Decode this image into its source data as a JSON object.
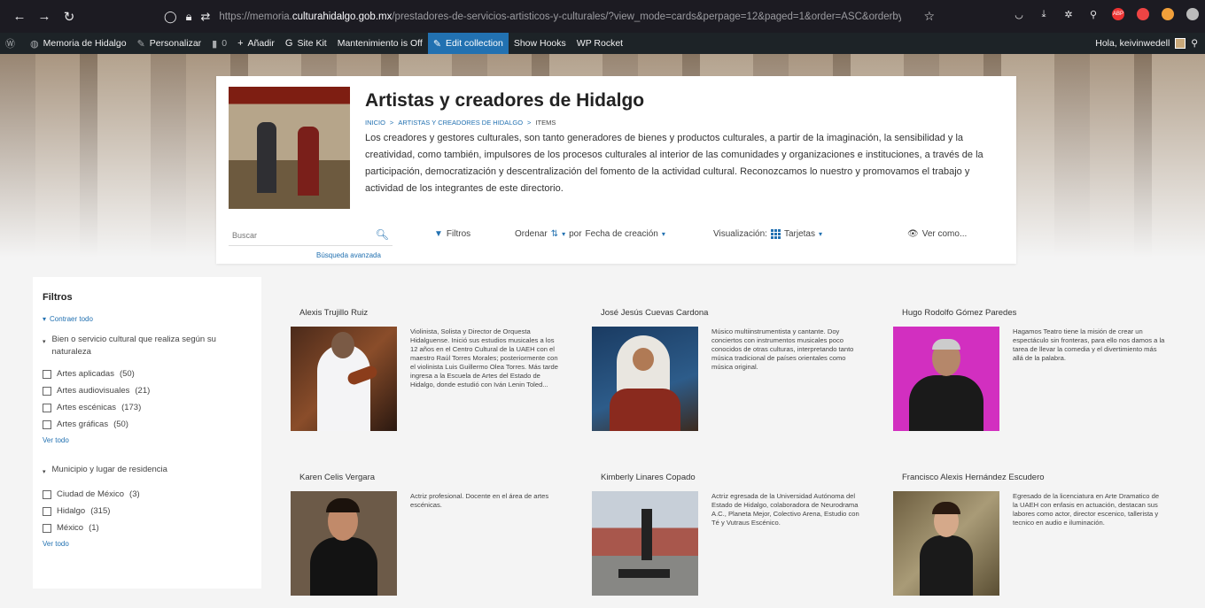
{
  "browser": {
    "url_prefix": "https://memoria.",
    "url_domain": "culturahidalgo.gob.mx",
    "url_path": "/prestadores-de-servicios-artisticos-y-culturales/?view_mode=cards&perpage=12&paged=1&order=ASC&orderby=date&fetch_only=thumbna"
  },
  "admin_bar": {
    "site_name": "Memoria de Hidalgo",
    "customize": "Personalizar",
    "comments_count": "0",
    "add_new": "Añadir",
    "site_kit": "Site Kit",
    "maintenance": "Mantenimiento is Off",
    "edit_collection": "Edit collection",
    "show_hooks": "Show Hooks",
    "wp_rocket": "WP Rocket",
    "greeting": "Hola, keivinwedell"
  },
  "header": {
    "title": "Artistas y creadores de Hidalgo",
    "breadcrumb": [
      "INICIO",
      "ARTISTAS Y CREADORES DE HIDALGO",
      "ITEMS"
    ],
    "breadcrumb_sep": ">",
    "description": "Los creadores y gestores culturales, son tanto generadores de bienes y productos culturales, a partir de la imaginación, la sensibilidad y la creatividad, como también, impulsores de los procesos culturales al interior de las comunidades y organizaciones e instituciones, a través de la participación, democratización y descentralización del fomento de la actividad cultural. Reconozcamos lo nuestro y promovamos el trabajo y actividad de los integrantes de este directorio."
  },
  "toolbar": {
    "search_placeholder": "Buscar",
    "advanced_search": "Búsqueda avanzada",
    "filters": "Filtros",
    "order_label": "Ordenar",
    "order_by": "por",
    "order_field": "Fecha de creación",
    "view_label": "Visualización:",
    "view_mode": "Tarjetas",
    "view_as": "Ver como..."
  },
  "filters": {
    "title": "Filtros",
    "collapse_all": "Contraer todo",
    "facets": [
      {
        "title": "Bien o servicio cultural que realiza según su naturaleza",
        "options": [
          {
            "label": "Artes aplicadas",
            "count": "(50)"
          },
          {
            "label": "Artes audiovisuales",
            "count": "(21)"
          },
          {
            "label": "Artes escénicas",
            "count": "(173)"
          },
          {
            "label": "Artes gráficas",
            "count": "(50)"
          }
        ],
        "see_all": "Ver todo"
      },
      {
        "title": "Municipio y lugar de residencia",
        "options": [
          {
            "label": "Ciudad de México",
            "count": "(3)"
          },
          {
            "label": "Hidalgo",
            "count": "(315)"
          },
          {
            "label": "México",
            "count": "(1)"
          }
        ],
        "see_all": "Ver todo"
      }
    ]
  },
  "items": [
    {
      "name": "Alexis Trujillo Ruiz",
      "desc": "Violinista, Solista y Director de Orquesta Hidalguense. Inició sus estudios musicales a los 12 años en el Centro Cultural de la UAEH con el maestro Raúl Torres Morales; posteriormente con el violinista Luis Guillermo Olea Torres. Más tarde ingresa a la Escuela de Artes del Estado de Hidalgo, donde estudió con Iván Lenin Toled..."
    },
    {
      "name": "José Jesús Cuevas Cardona",
      "desc": "Músico multiinstrumentista y cantante. Doy conciertos con instrumentos musicales poco conocidos de otras culturas, interpretando tanto música tradicional de países orientales como música original."
    },
    {
      "name": "Hugo Rodolfo Gómez Paredes",
      "desc": "Hagamos Teatro tiene la misión de crear un espectáculo sin fronteras, para ello nos damos a la tarea de llevar la comedia y el divertimiento más allá de la palabra."
    },
    {
      "name": "Karen Celis Vergara",
      "desc": "Actriz profesional. Docente en el área de artes escénicas."
    },
    {
      "name": "Kimberly Linares Copado",
      "desc": "Actriz egresada de la Universidad Autónoma del Estado de Hidalgo, colaboradora de Neurodrama A.C., Planeta Mejor, Colectivo Arena, Estudio con Té y Vutraus Escénico."
    },
    {
      "name": "Francisco Alexis Hernández Escudero",
      "desc": "Egresado de la licenciatura en Arte Dramatico de la UAEH con enfasis en actuación, destacan sus labores como actor, director escenico, tallerista y tecnico en audio e iluminación."
    }
  ],
  "colors": {
    "accent": "#2271b1",
    "admin_bar": "#1d2327",
    "browser_bar": "#1c1b22"
  }
}
